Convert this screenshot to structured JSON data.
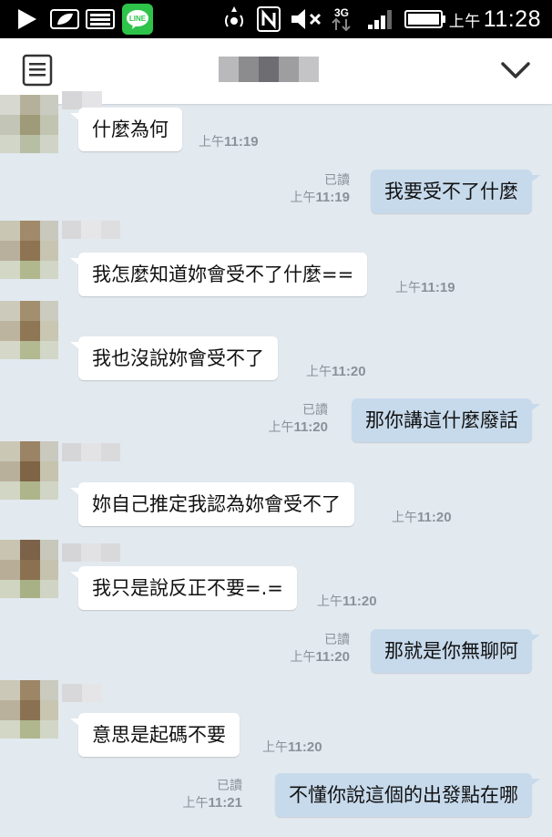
{
  "status_bar": {
    "ampm": "上午",
    "time": "11:28",
    "network": "3G"
  },
  "header": {
    "contact_name": ""
  },
  "messages": [
    {
      "dir": "in",
      "text": "什麼為何",
      "ampm": "上午",
      "time": "11:19"
    },
    {
      "dir": "out",
      "text": "我要受不了什麼",
      "read": "已讀",
      "ampm": "上午",
      "time": "11:19"
    },
    {
      "dir": "in",
      "text": "我怎麼知道妳會受不了什麼==",
      "ampm": "上午",
      "time": "11:19"
    },
    {
      "dir": "in",
      "text": "我也沒說妳會受不了",
      "ampm": "上午",
      "time": "11:20"
    },
    {
      "dir": "out",
      "text": "那你講這什麼廢話",
      "read": "已讀",
      "ampm": "上午",
      "time": "11:20"
    },
    {
      "dir": "in",
      "text": "妳自己推定我認為妳會受不了",
      "ampm": "上午",
      "time": "11:20"
    },
    {
      "dir": "in",
      "text": "我只是說反正不要=.=",
      "ampm": "上午",
      "time": "11:20"
    },
    {
      "dir": "out",
      "text": "那就是你無聊阿",
      "read": "已讀",
      "ampm": "上午",
      "time": "11:20"
    },
    {
      "dir": "in",
      "text": "意思是起碼不要",
      "ampm": "上午",
      "time": "11:20"
    },
    {
      "dir": "out",
      "text": "不懂你說這個的出發點在哪",
      "read": "已讀",
      "ampm": "上午",
      "time": "11:21"
    }
  ],
  "colors": {
    "chat_bg": "#e2e9ef",
    "bubble_in": "#ffffff",
    "bubble_out": "#c7daec",
    "line_green": "#2ec44a",
    "status_bg": "#000000"
  },
  "icons": [
    "play-icon",
    "leaf-icon",
    "keyboard-icon",
    "line-app-icon",
    "hotspot-icon",
    "nfc-icon",
    "mute-icon",
    "signal-icon",
    "battery-icon",
    "menu-icon",
    "chevron-down-icon"
  ]
}
